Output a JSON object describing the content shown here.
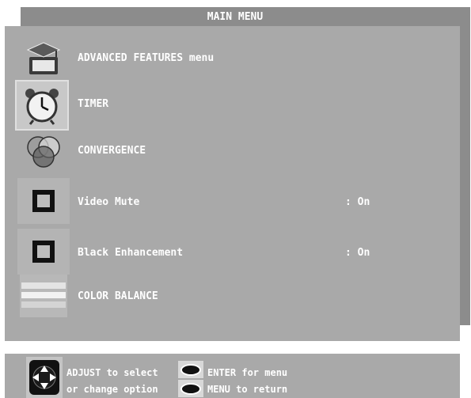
{
  "header": {
    "title": "MAIN MENU"
  },
  "menu": {
    "items": [
      {
        "label": "ADVANCED FEATURES menu",
        "value": "",
        "icon": "graduation-cap-icon"
      },
      {
        "label": "TIMER",
        "value": "",
        "icon": "alarm-clock-icon",
        "selected": true
      },
      {
        "label": "CONVERGENCE",
        "value": "",
        "icon": "rgb-circles-icon"
      },
      {
        "label": "Video Mute",
        "value": ": On",
        "icon": "screen-square-icon"
      },
      {
        "label": "Black Enhancement",
        "value": ": On",
        "icon": "screen-square-icon"
      },
      {
        "label": "COLOR BALANCE",
        "value": "",
        "icon": "color-bars-icon"
      }
    ]
  },
  "footer": {
    "adjust_line1": "ADJUST to select",
    "adjust_line2": "or change option",
    "enter_label": "ENTER for menu",
    "menu_label": "MENU  to  return"
  },
  "colors": {
    "panel": "#a9a9a9",
    "title_bar": "#8c8c8c",
    "text": "#ffffff"
  }
}
